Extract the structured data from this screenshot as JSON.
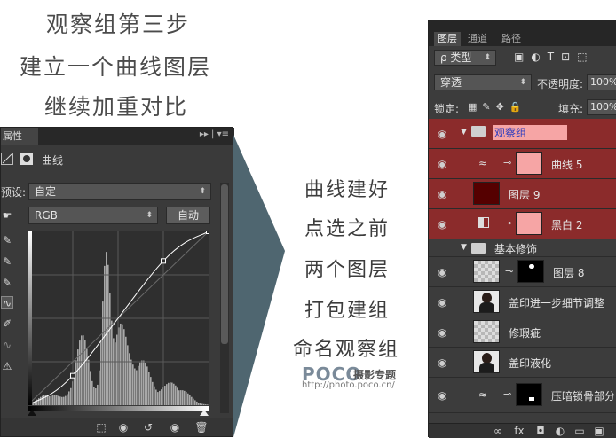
{
  "captions": {
    "line1": "观察组第三步",
    "line2": "建立一个曲线图层",
    "line3": "继续加重对比"
  },
  "middle_text": {
    "line1": "曲线建好",
    "line2": "点选之前",
    "line3": "两个图层",
    "line4": "打包建组",
    "line5": "命名观察组"
  },
  "watermark": {
    "brand": "POCO",
    "brand_sub": "摄影专题",
    "url": "http://photo.poco.cn/"
  },
  "curves_panel": {
    "tab_label": "属性",
    "menu_icons": "▸▸ | ▾≡",
    "adjustment_title": "曲线",
    "preset_label": "预设:",
    "preset_value": "自定",
    "channel_value": "RGB",
    "auto_button": "自动",
    "curve_points": [
      [
        0,
        0
      ],
      [
        0.25,
        0.17
      ],
      [
        0.75,
        0.83
      ],
      [
        1,
        1
      ]
    ],
    "histogram_color": "#a8a8a8"
  },
  "layers_panel": {
    "tabs": [
      "图层",
      "通道",
      "路径"
    ],
    "active_tab": "图层",
    "filter_label": "ρ 类型",
    "blend_mode": "穿透",
    "opacity_label": "不透明度:",
    "opacity_value": "100%",
    "lock_label": "锁定:",
    "fill_label": "填充:",
    "fill_value": "100%",
    "group_highlight_color": "#8b2b2b",
    "layers": [
      {
        "name": "观察组",
        "type": "group",
        "expanded": true,
        "selected": true
      },
      {
        "name": "曲线 5",
        "type": "adjustment",
        "color": "red",
        "icon": "curves-icon"
      },
      {
        "name": "图层 9",
        "type": "pixel",
        "color": "red",
        "thumb": "dark-red"
      },
      {
        "name": "黑白 2",
        "type": "adjustment",
        "color": "red",
        "icon": "black-white-icon"
      },
      {
        "name": "基本修饰",
        "type": "group",
        "expanded": true
      },
      {
        "name": "图层 8",
        "type": "pixel",
        "thumb": "checker-mask"
      },
      {
        "name": "盖印进一步细节调整",
        "type": "pixel",
        "thumb": "portrait"
      },
      {
        "name": "修瑕疵",
        "type": "pixel",
        "thumb": "checker"
      },
      {
        "name": "盖印液化",
        "type": "pixel",
        "thumb": "portrait"
      },
      {
        "name": "压暗锁骨部分",
        "type": "adjustment",
        "icon": "curves-icon"
      }
    ],
    "bottom_icons": [
      "link-icon",
      "fx-icon",
      "mask-icon",
      "adjustment-icon",
      "folder-icon",
      "new-layer-icon",
      "trash-icon"
    ]
  }
}
